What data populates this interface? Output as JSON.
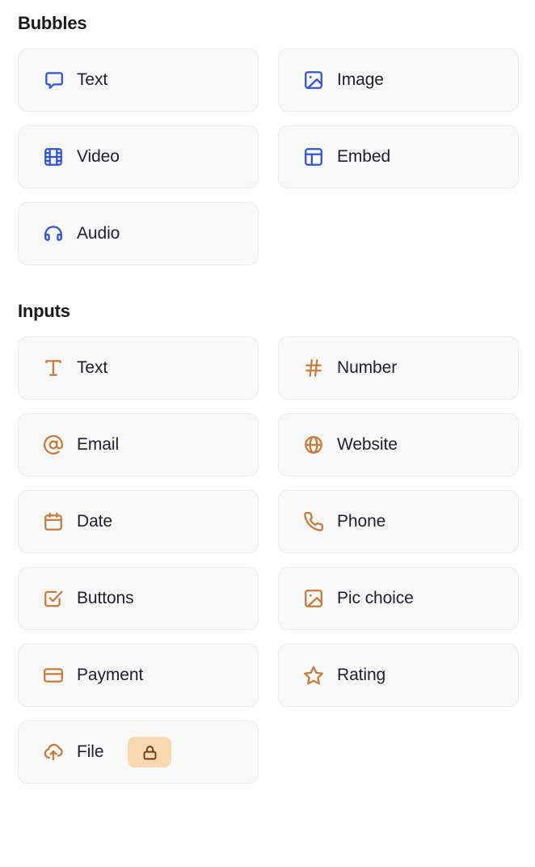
{
  "theme": {
    "bubble_icon_color": "#2f55d4",
    "input_icon_color": "#c97b3c",
    "card_background": "#f9f9fa",
    "card_border": "#ececee",
    "label_color": "#20202a",
    "title_color": "#1a1a1c",
    "lock_badge_background": "#f7d8b0",
    "lock_badge_icon": "#6b3f18",
    "page_background": "#ffffff"
  },
  "sections": [
    {
      "id": "bubbles",
      "title": "Bubbles",
      "items": [
        {
          "label": "Text",
          "icon": "chat-bubble-icon",
          "locked": false
        },
        {
          "label": "Image",
          "icon": "image-icon",
          "locked": false
        },
        {
          "label": "Video",
          "icon": "film-strip-icon",
          "locked": false
        },
        {
          "label": "Embed",
          "icon": "layout-panel-icon",
          "locked": false
        },
        {
          "label": "Audio",
          "icon": "headphones-icon",
          "locked": false
        }
      ]
    },
    {
      "id": "inputs",
      "title": "Inputs",
      "items": [
        {
          "label": "Text",
          "icon": "text-t-icon",
          "locked": false
        },
        {
          "label": "Number",
          "icon": "hash-icon",
          "locked": false
        },
        {
          "label": "Email",
          "icon": "at-sign-icon",
          "locked": false
        },
        {
          "label": "Website",
          "icon": "globe-icon",
          "locked": false
        },
        {
          "label": "Date",
          "icon": "calendar-icon",
          "locked": false
        },
        {
          "label": "Phone",
          "icon": "phone-icon",
          "locked": false
        },
        {
          "label": "Buttons",
          "icon": "checkbox-check-icon",
          "locked": false
        },
        {
          "label": "Pic choice",
          "icon": "image-icon",
          "locked": false
        },
        {
          "label": "Payment",
          "icon": "credit-card-icon",
          "locked": false
        },
        {
          "label": "Rating",
          "icon": "star-icon",
          "locked": false
        },
        {
          "label": "File",
          "icon": "cloud-upload-icon",
          "locked": true,
          "lock_icon": "lock-icon"
        }
      ]
    }
  ]
}
